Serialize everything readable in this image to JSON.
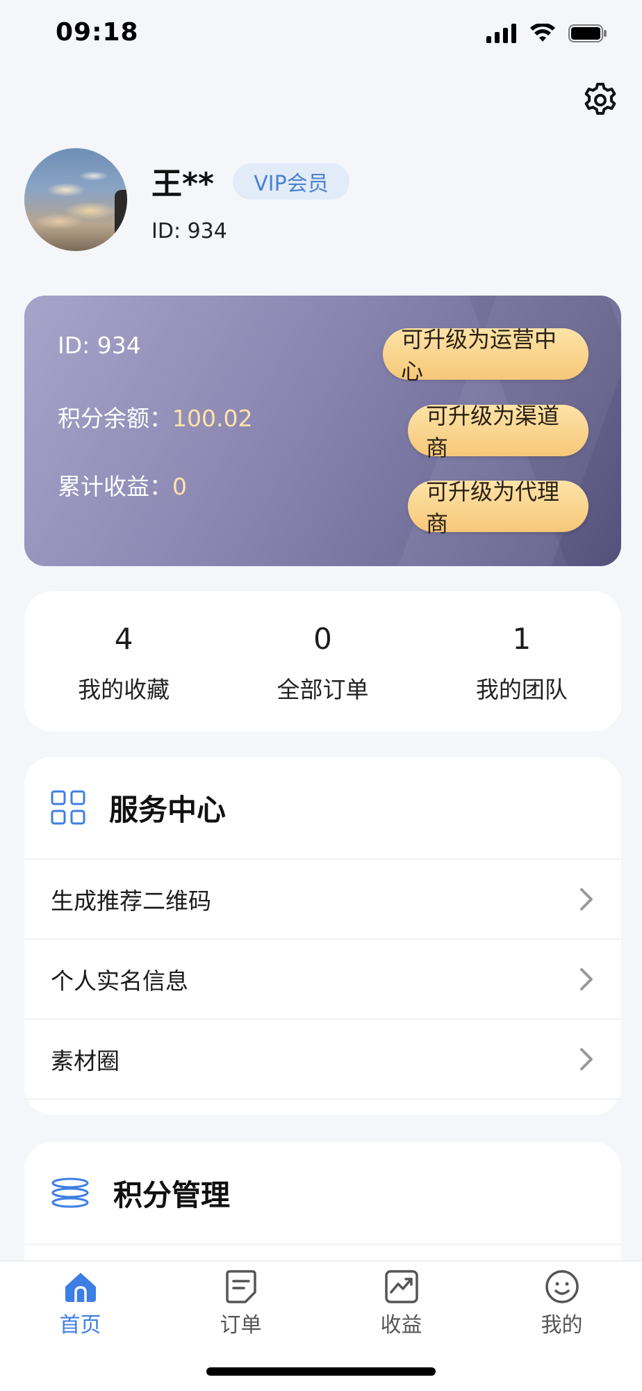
{
  "status_bar": {
    "time": "09:18"
  },
  "profile": {
    "name": "王**",
    "badge": "VIP会员",
    "id_text": "ID: 934"
  },
  "card": {
    "id_text": "ID: 934",
    "points_label": "积分余额：",
    "points_value": "100.02",
    "earnings_label": "累计收益：",
    "earnings_value": "0",
    "upgrade_buttons": [
      "可升级为运营中心",
      "可升级为渠道商",
      "可升级为代理商"
    ]
  },
  "stats": [
    {
      "value": "4",
      "label": "我的收藏"
    },
    {
      "value": "0",
      "label": "全部订单"
    },
    {
      "value": "1",
      "label": "我的团队"
    }
  ],
  "service_center": {
    "title": "服务中心",
    "icon": "grid-icon",
    "items": [
      "生成推荐二维码",
      "个人实名信息",
      "素材圈"
    ]
  },
  "points_management": {
    "title": "积分管理",
    "icon": "layers-icon"
  },
  "bottom_nav": {
    "items": [
      {
        "label": "首页",
        "icon": "home-icon",
        "active": true
      },
      {
        "label": "订单",
        "icon": "order-icon",
        "active": false
      },
      {
        "label": "收益",
        "icon": "earnings-icon",
        "active": false
      },
      {
        "label": "我的",
        "icon": "smile-icon",
        "active": false
      }
    ]
  },
  "colors": {
    "accent": "#3d7ee5",
    "card_gradient_start": "#a7a3c9",
    "card_gradient_end": "#5a5783",
    "gold_value": "#ffe4a6",
    "background": "#f4f6fa"
  }
}
